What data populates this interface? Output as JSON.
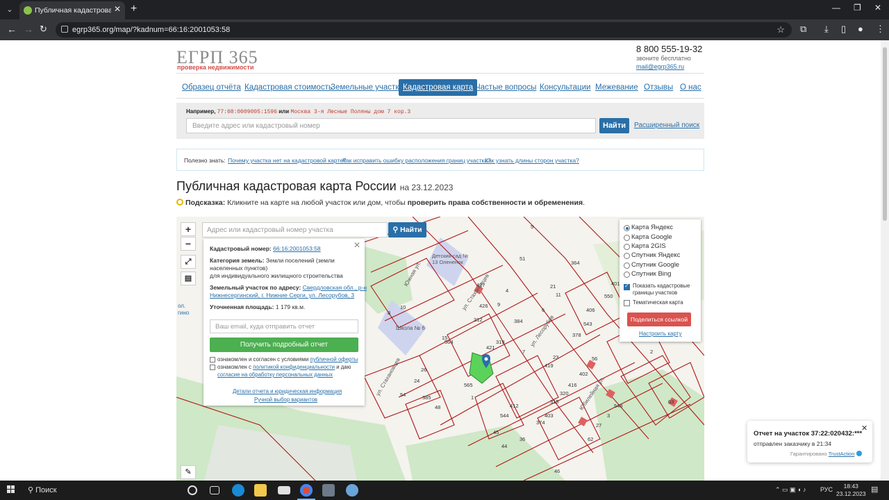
{
  "browser": {
    "tab_title": "Публичная кадастровая к",
    "url": "egrp365.org/map/?kadnum=66:16:2001053:58"
  },
  "header": {
    "logo": "ЕГРП 365",
    "logo_sub": "проверка недвижимости",
    "phone": "8 800 555-19-32",
    "phone_note": "звоните бесплатно",
    "email": "mail@egrp365.ru"
  },
  "menu": [
    "Образец отчёта",
    "Кадастровая стоимость",
    "Земельные участки",
    "Кадастровая карта",
    "Частые вопросы",
    "Консультации",
    "Межевание",
    "Отзывы",
    "О нас"
  ],
  "search": {
    "example_prefix": "Например,",
    "example_1": "77:08:0009005:1596",
    "example_or": "или",
    "example_2": "Москва 3-я Лесные Поляны дом 7 кор.3",
    "placeholder": "Введите адрес или кадастровый номер",
    "button": "Найти",
    "advanced": "Расширенный поиск"
  },
  "tips": {
    "label": "Полезно знать:",
    "links": [
      "Почему участка нет на кадастровой карте?",
      "Как исправить ошибку расположения границ участка?",
      "Как узнать длины сторон участка?"
    ]
  },
  "title": "Публичная кадастровая карта России",
  "title_date": "на 23.12.2023",
  "hint": {
    "label": "Подсказка:",
    "text": "Кликните на карте на любой участок или дом, чтобы",
    "bold": "проверить права собственности и обременения",
    "end": "."
  },
  "map": {
    "zoom_in": "+",
    "zoom_out": "−",
    "search_placeholder": "Адрес или кадастровый номер участка",
    "search_button": "Найти",
    "labels": {
      "street1": "Южная ул.",
      "street2": "ул. Стахановцев",
      "street3": "ул. Лесорубов",
      "street4": "ул. Стахановцев",
      "street5": "Юбилейная ул.",
      "kindergarten": "Детский сад № 13 Олененок",
      "school": "Школа № 6",
      "side1": "ол.",
      "side2": "гино"
    },
    "plots": [
      "427",
      "426",
      "312",
      "319",
      "384",
      "564",
      "421",
      "565",
      "51",
      "21",
      "11",
      "23",
      "419",
      "56",
      "378",
      "543",
      "406",
      "550",
      "401",
      "364",
      "412",
      "544",
      "403",
      "315",
      "374",
      "320",
      "416",
      "402",
      "27",
      "548",
      "62",
      "63",
      "36",
      "45",
      "44",
      "46",
      "48",
      "54",
      "24",
      "26",
      "385",
      "8",
      "10",
      "15",
      "4",
      "5",
      "6",
      "7",
      "9",
      "3",
      "2",
      "1"
    ]
  },
  "popup": {
    "cad_label": "Кадастровый номер:",
    "cad_value": "66:16:2001053:58",
    "cat_label": "Категория земель:",
    "cat_value_1": "Земли поселений (земли",
    "cat_value_2": "населенных пунктов)",
    "cat_value_3": "для индивидуального жилищного строительства",
    "addr_label": "Земельный участок по адресу:",
    "addr_value_1": "Свердловская обл., р-н",
    "addr_value_2": "Нижнесергинский, г. Нижние Серги, ул. Лесорубов, 3",
    "area_label": "Уточненная площадь:",
    "area_value": "1 179 кв.м.",
    "email_placeholder": "Ваш email, куда отправить отчет",
    "report_button": "Получить подробный отчет",
    "agree_1a": "ознакомлен и согласен с условиями",
    "agree_1b": "публичной оферты",
    "agree_2a": "ознакомлен с",
    "agree_2b": "политикой конфиденциальности",
    "agree_2c": "и даю",
    "agree_2d": "согласие на обработку персональных данных",
    "details": "Детали отчета и юридическая информация",
    "manual": "Ручной выбор вариантов"
  },
  "layers": {
    "options": [
      "Карта Яндекс",
      "Карта Google",
      "Карта 2GIS",
      "Спутник Яндекс",
      "Спутник Google",
      "Спутник Bing"
    ],
    "selected": "Карта Яндекс",
    "show_borders_1": "Показать кадастровые",
    "show_borders_2": "границы участков",
    "thematic": "Тематическая карта",
    "share": "Поделиться ссылкой",
    "configure": "Настроить карту"
  },
  "notification": {
    "title": "Отчет на участок 37:22:020432:***",
    "text": "отправлен заказчику в 21:34",
    "guarantee": "Гарантировано",
    "brand": "TrustAction"
  },
  "taskbar": {
    "search": "Поиск",
    "lang": "РУС",
    "time": "18:43",
    "date": "23.12.2023"
  }
}
